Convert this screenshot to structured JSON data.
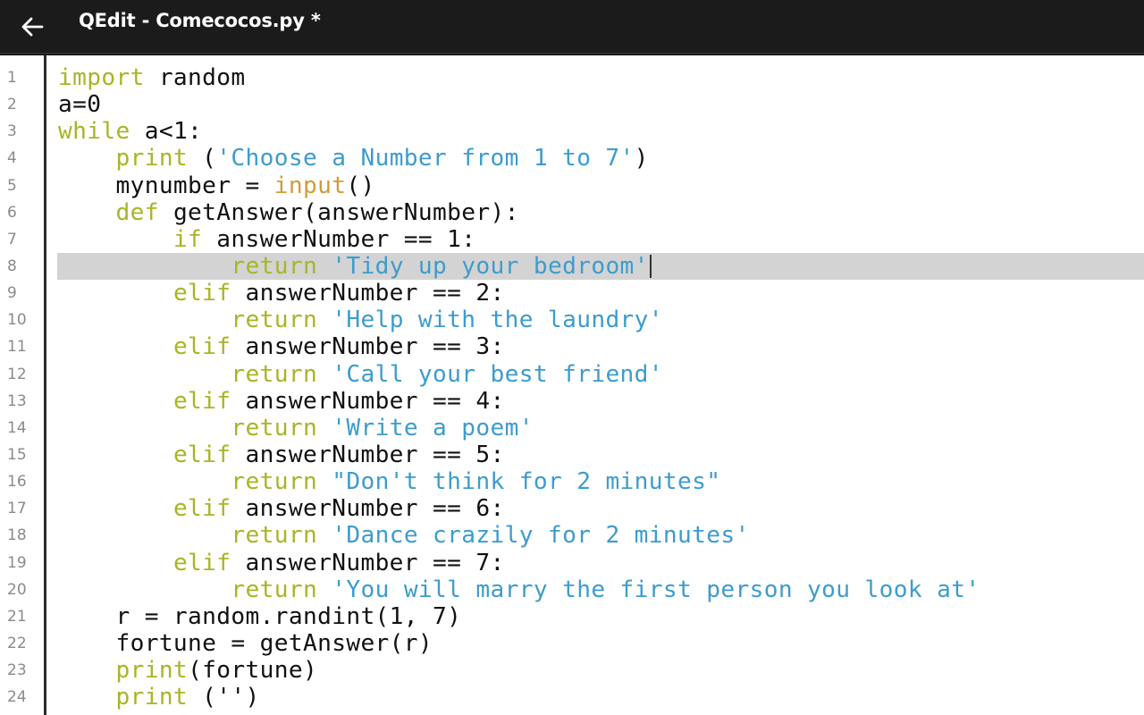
{
  "app": {
    "title": "QEdit - Comecocos.py *",
    "back_icon": "arrow-left-icon"
  },
  "colors": {
    "topbar_bg": "#1b1b1b",
    "editor_bg": "#ffffff",
    "keyword": "#a8b526",
    "string": "#3d9ccd",
    "builtin": "#d29b3a",
    "current_line_highlight": "#d3d3d3",
    "line_number": "#8a8a8a"
  },
  "editor": {
    "current_line": 8,
    "lines": [
      {
        "n": "1",
        "tokens": [
          {
            "t": "import",
            "c": "kw"
          },
          {
            "t": " random",
            "c": ""
          }
        ]
      },
      {
        "n": "2",
        "tokens": [
          {
            "t": "a=0",
            "c": ""
          }
        ]
      },
      {
        "n": "3",
        "tokens": [
          {
            "t": "while",
            "c": "kw"
          },
          {
            "t": " a<1:",
            "c": ""
          }
        ]
      },
      {
        "n": "4",
        "tokens": [
          {
            "t": "    ",
            "c": ""
          },
          {
            "t": "print",
            "c": "kw"
          },
          {
            "t": " (",
            "c": ""
          },
          {
            "t": "'Choose a Number from 1 to 7'",
            "c": "st"
          },
          {
            "t": ")",
            "c": ""
          }
        ]
      },
      {
        "n": "5",
        "tokens": [
          {
            "t": "    mynumber = ",
            "c": ""
          },
          {
            "t": "input",
            "c": "bi"
          },
          {
            "t": "()",
            "c": ""
          }
        ]
      },
      {
        "n": "6",
        "tokens": [
          {
            "t": "    ",
            "c": ""
          },
          {
            "t": "def",
            "c": "kw"
          },
          {
            "t": " getAnswer(answerNumber):",
            "c": ""
          }
        ]
      },
      {
        "n": "7",
        "tokens": [
          {
            "t": "        ",
            "c": ""
          },
          {
            "t": "if",
            "c": "kw"
          },
          {
            "t": " answerNumber == 1:",
            "c": ""
          }
        ]
      },
      {
        "n": "8",
        "tokens": [
          {
            "t": "            ",
            "c": ""
          },
          {
            "t": "return",
            "c": "kw"
          },
          {
            "t": " ",
            "c": ""
          },
          {
            "t": "'Tidy up your bedroom'",
            "c": "st"
          }
        ]
      },
      {
        "n": "9",
        "tokens": [
          {
            "t": "        ",
            "c": ""
          },
          {
            "t": "elif",
            "c": "kw"
          },
          {
            "t": " answerNumber == 2:",
            "c": ""
          }
        ]
      },
      {
        "n": "10",
        "tokens": [
          {
            "t": "            ",
            "c": ""
          },
          {
            "t": "return",
            "c": "kw"
          },
          {
            "t": " ",
            "c": ""
          },
          {
            "t": "'Help with the laundry'",
            "c": "st"
          }
        ]
      },
      {
        "n": "11",
        "tokens": [
          {
            "t": "        ",
            "c": ""
          },
          {
            "t": "elif",
            "c": "kw"
          },
          {
            "t": " answerNumber == 3:",
            "c": ""
          }
        ]
      },
      {
        "n": "12",
        "tokens": [
          {
            "t": "            ",
            "c": ""
          },
          {
            "t": "return",
            "c": "kw"
          },
          {
            "t": " ",
            "c": ""
          },
          {
            "t": "'Call your best friend'",
            "c": "st"
          }
        ]
      },
      {
        "n": "13",
        "tokens": [
          {
            "t": "        ",
            "c": ""
          },
          {
            "t": "elif",
            "c": "kw"
          },
          {
            "t": " answerNumber == 4:",
            "c": ""
          }
        ]
      },
      {
        "n": "14",
        "tokens": [
          {
            "t": "            ",
            "c": ""
          },
          {
            "t": "return",
            "c": "kw"
          },
          {
            "t": " ",
            "c": ""
          },
          {
            "t": "'Write a poem'",
            "c": "st"
          }
        ]
      },
      {
        "n": "15",
        "tokens": [
          {
            "t": "        ",
            "c": ""
          },
          {
            "t": "elif",
            "c": "kw"
          },
          {
            "t": " answerNumber == 5:",
            "c": ""
          }
        ]
      },
      {
        "n": "16",
        "tokens": [
          {
            "t": "            ",
            "c": ""
          },
          {
            "t": "return",
            "c": "kw"
          },
          {
            "t": " ",
            "c": ""
          },
          {
            "t": "\"Don't think for 2 minutes\"",
            "c": "st"
          }
        ]
      },
      {
        "n": "17",
        "tokens": [
          {
            "t": "        ",
            "c": ""
          },
          {
            "t": "elif",
            "c": "kw"
          },
          {
            "t": " answerNumber == 6:",
            "c": ""
          }
        ]
      },
      {
        "n": "18",
        "tokens": [
          {
            "t": "            ",
            "c": ""
          },
          {
            "t": "return",
            "c": "kw"
          },
          {
            "t": " ",
            "c": ""
          },
          {
            "t": "'Dance crazily for 2 minutes'",
            "c": "st"
          }
        ]
      },
      {
        "n": "19",
        "tokens": [
          {
            "t": "        ",
            "c": ""
          },
          {
            "t": "elif",
            "c": "kw"
          },
          {
            "t": " answerNumber == 7:",
            "c": ""
          }
        ]
      },
      {
        "n": "20",
        "tokens": [
          {
            "t": "            ",
            "c": ""
          },
          {
            "t": "return",
            "c": "kw"
          },
          {
            "t": " ",
            "c": ""
          },
          {
            "t": "'You will marry the first person you look at'",
            "c": "st"
          }
        ]
      },
      {
        "n": "21",
        "tokens": [
          {
            "t": "    r = random.randint(1, 7)",
            "c": ""
          }
        ]
      },
      {
        "n": "22",
        "tokens": [
          {
            "t": "    fortune = getAnswer(r)",
            "c": ""
          }
        ]
      },
      {
        "n": "23",
        "tokens": [
          {
            "t": "    ",
            "c": ""
          },
          {
            "t": "print",
            "c": "kw"
          },
          {
            "t": "(fortune)",
            "c": ""
          }
        ]
      },
      {
        "n": "24",
        "tokens": [
          {
            "t": "    ",
            "c": ""
          },
          {
            "t": "print",
            "c": "kw"
          },
          {
            "t": " ('')",
            "c": ""
          }
        ]
      }
    ]
  }
}
